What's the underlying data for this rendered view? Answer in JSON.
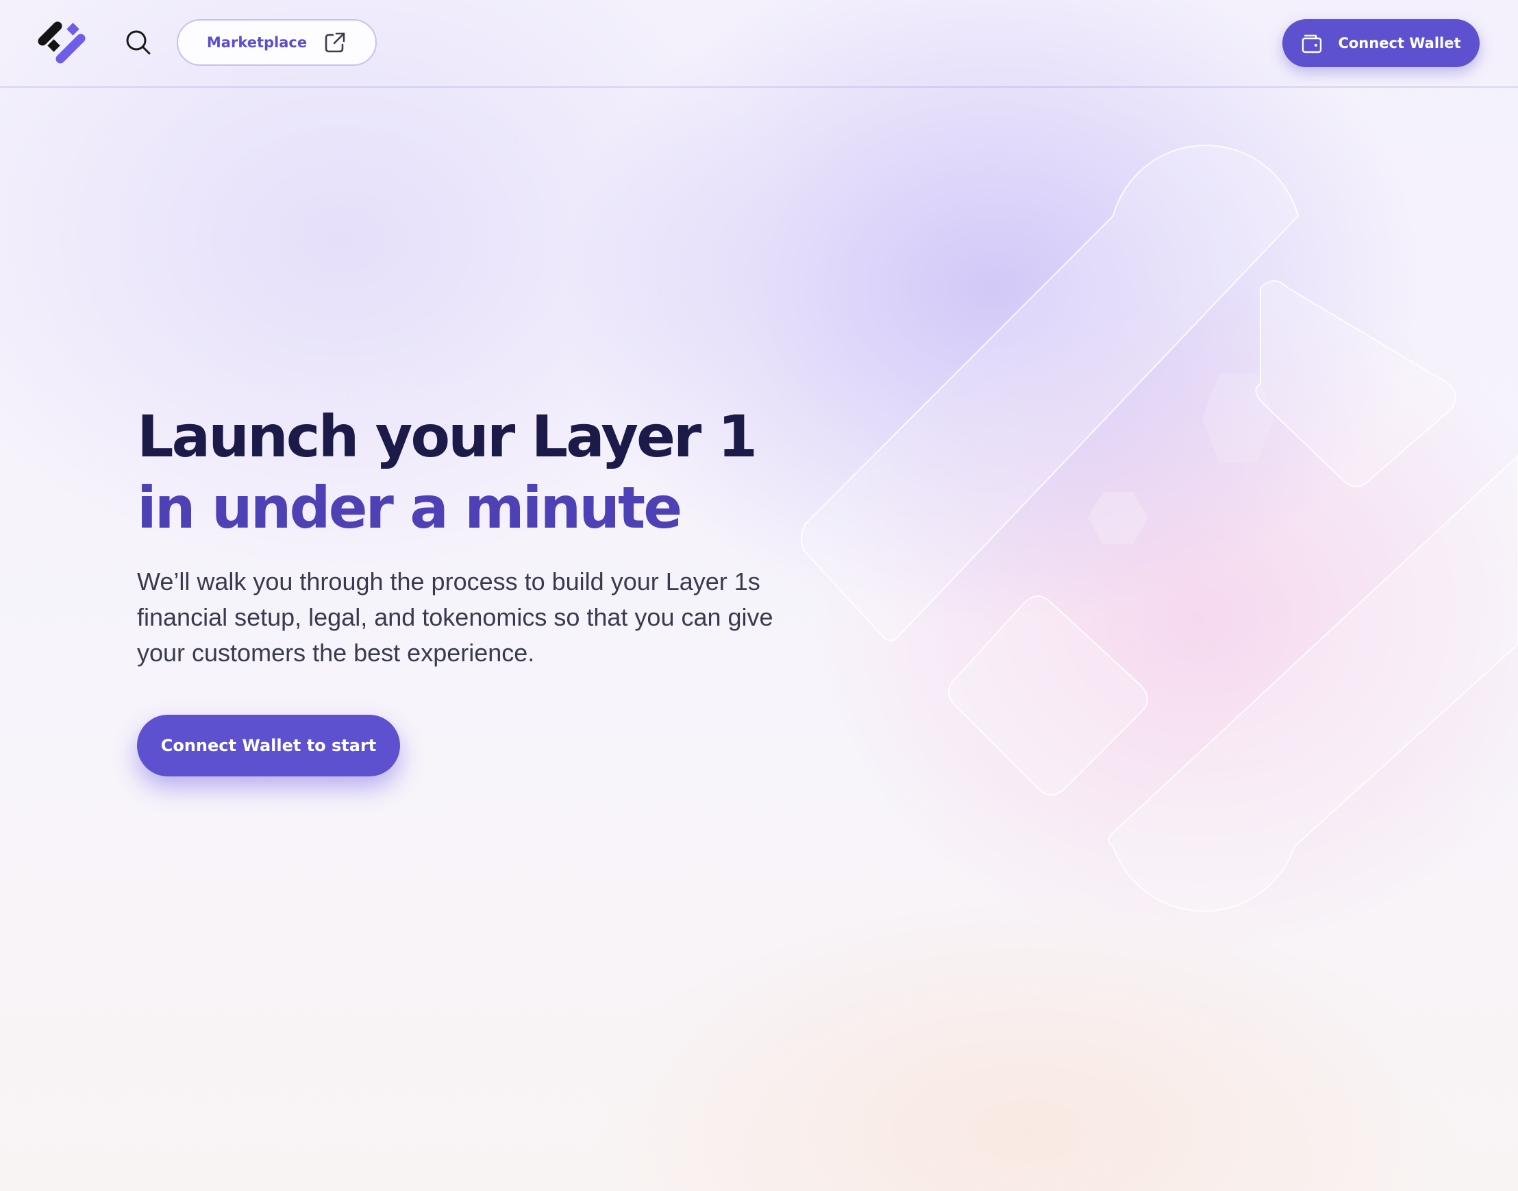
{
  "header": {
    "marketplace_label": "Marketplace",
    "connect_wallet_label": "Connect Wallet"
  },
  "hero": {
    "title_line1": "Launch your Layer 1",
    "title_line2": "in under a minute",
    "description": "We’ll walk you through the process to build your Layer 1s financial setup, legal, and tokenomics so that you can give your customers the best experience.",
    "cta_label": "Connect Wallet to start"
  },
  "icons": {
    "logo": "brand-logo",
    "search": "search-icon",
    "marketplace": "external-link-icon",
    "wallet": "wallet-icon"
  },
  "colors": {
    "accent": "#5d51cf",
    "heading_dark": "#1c1a48",
    "heading_accent": "#4e41b5",
    "body_text": "#3a3a4e"
  }
}
